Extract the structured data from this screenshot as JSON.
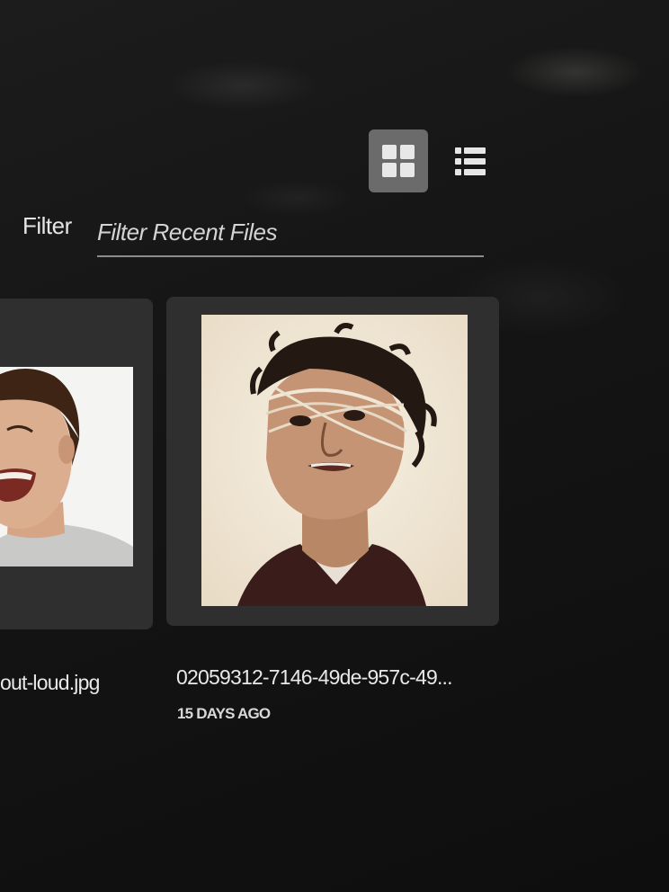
{
  "view_toggle": {
    "grid_icon": "grid-view-icon",
    "list_icon": "list-view-icon",
    "active": "grid"
  },
  "filter": {
    "label": "Filter",
    "placeholder": "Filter Recent Files",
    "value": ""
  },
  "recent_files": [
    {
      "name": "out-loud.jpg",
      "date": ""
    },
    {
      "name": "02059312-7146-49de-957c-49...",
      "date": "15 DAYS AGO"
    }
  ],
  "colors": {
    "background": "#141414",
    "card": "#2f2f2f",
    "active_toggle": "#6b6b6b",
    "text": "#e8e8e8"
  }
}
